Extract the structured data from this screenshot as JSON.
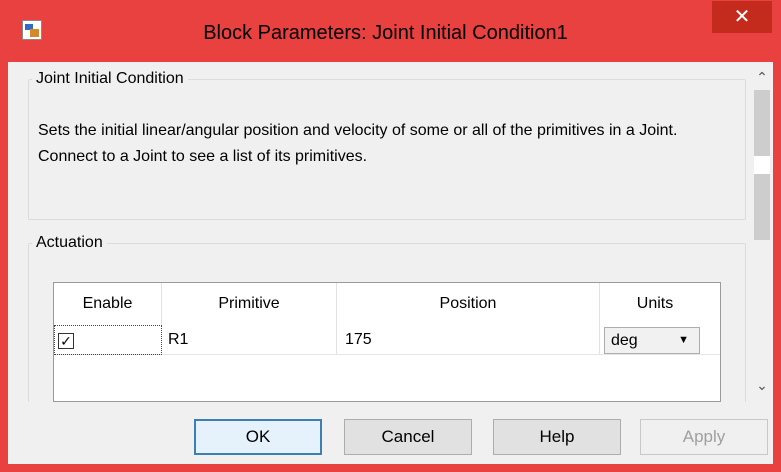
{
  "window": {
    "title": "Block Parameters: Joint Initial Condition1",
    "close_glyph": "✕"
  },
  "section_main": {
    "legend": "Joint Initial Condition",
    "description": "Sets the initial linear/angular position and velocity of some or all of the primitives in a Joint. Connect to a Joint to see a list of its primitives."
  },
  "section_actuation": {
    "legend": "Actuation",
    "table": {
      "headers": [
        "Enable",
        "Primitive",
        "Position",
        "Units"
      ],
      "rows": [
        {
          "enabled": true,
          "check_glyph": "✓",
          "primitive": "R1",
          "position": "175",
          "units": "deg"
        }
      ]
    }
  },
  "buttons": {
    "ok": "OK",
    "cancel": "Cancel",
    "help": "Help",
    "apply": "Apply"
  },
  "scrollbar": {
    "up": "⌃",
    "down": "⌄"
  },
  "colors": {
    "title_bar": "#e8413f",
    "close_button": "#c42b1c",
    "client_bg": "#f0f0f0"
  }
}
